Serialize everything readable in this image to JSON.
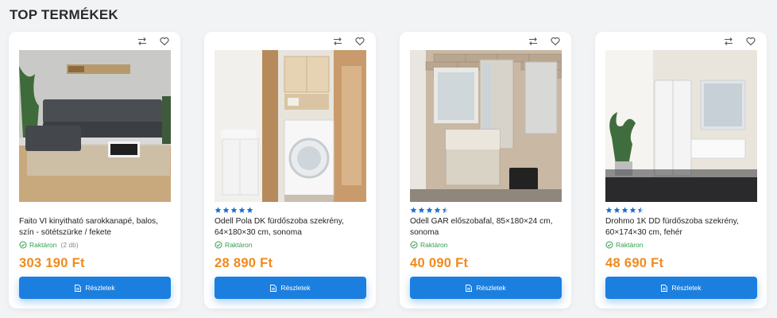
{
  "section": {
    "title": "TOP TERMÉKEK"
  },
  "colors": {
    "price": "#f08a1c",
    "button": "#1b7fe0",
    "stock": "#2fa04a",
    "star": "#1b6fd1"
  },
  "products": [
    {
      "title": "Faito VI kinyitható sarokkanapé, balos, szín - sötétszürke / fekete",
      "stock_label": "Raktáron",
      "stock_qty": "(2 db)",
      "price": "303 190 Ft",
      "button_label": "Részletek",
      "rating": 0,
      "image": "sofa"
    },
    {
      "title": "Odell Pola DK fürdőszoba szekrény, 64×180×30 cm, sonoma",
      "stock_label": "Raktáron",
      "stock_qty": "",
      "price": "28 890 Ft",
      "button_label": "Részletek",
      "rating": 5,
      "image": "bathroom-cabinet"
    },
    {
      "title": "Odell GAR előszobafal, 85×180×24 cm, sonoma",
      "stock_label": "Raktáron",
      "stock_qty": "",
      "price": "40 090 Ft",
      "button_label": "Részletek",
      "rating": 4.5,
      "image": "hallway"
    },
    {
      "title": "Drohmo 1K DD fürdőszoba szekrény, 60×174×30 cm, fehér",
      "stock_label": "Raktáron",
      "stock_qty": "",
      "price": "48 690 Ft",
      "button_label": "Részletek",
      "rating": 4.5,
      "image": "white-bathroom"
    }
  ]
}
